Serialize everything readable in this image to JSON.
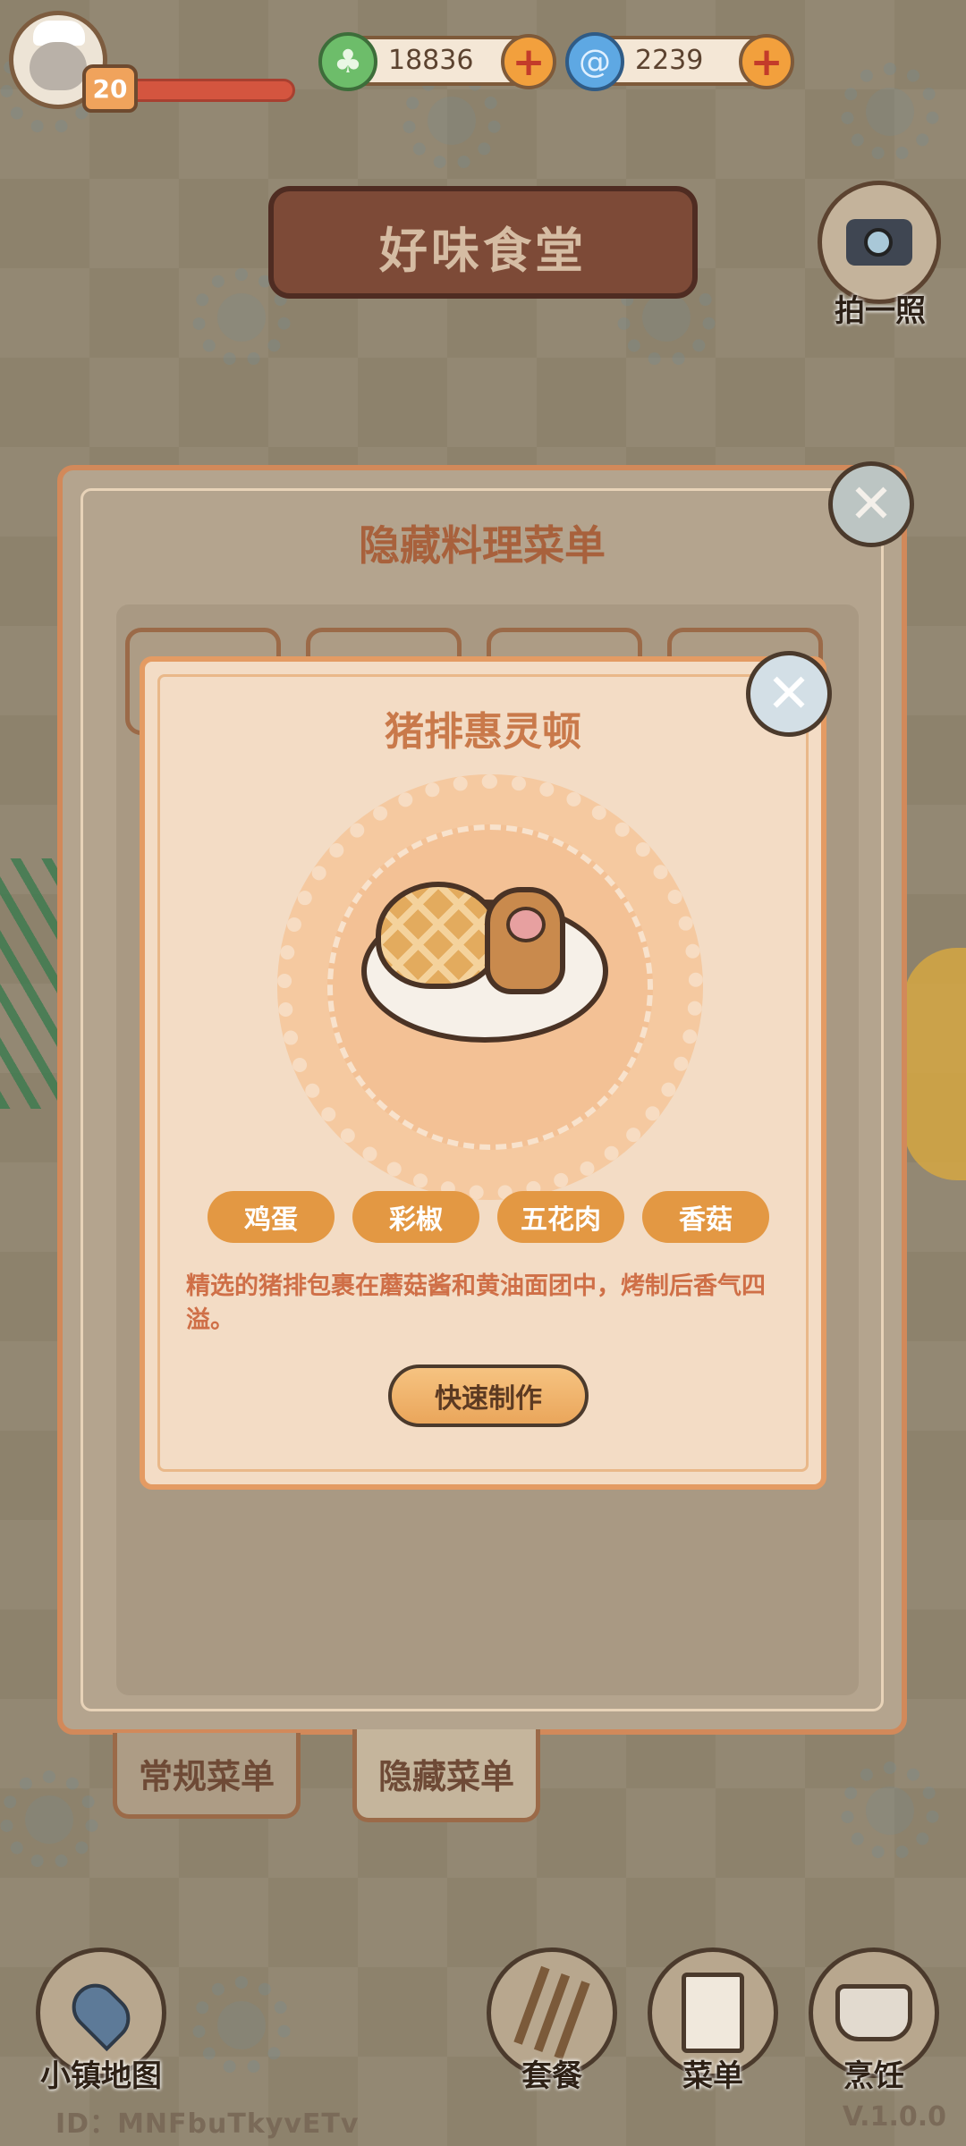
{
  "player": {
    "level": "20",
    "currency_leaf": "18836",
    "currency_swirl": "2239"
  },
  "header": {
    "shop_name": "好味食堂",
    "camera_label": "拍一照"
  },
  "outer_panel": {
    "title": "隐藏料理菜单",
    "tabs": [
      {
        "label": "常规菜单"
      },
      {
        "label": "隐藏菜单"
      }
    ]
  },
  "detail": {
    "dish_name": "猪排惠灵顿",
    "ingredients": [
      "鸡蛋",
      "彩椒",
      "五花肉",
      "香菇"
    ],
    "description": "精选的猪排包裹在蘑菇酱和黄油面团中，烤制后香气四溢。",
    "quick_make_label": "快速制作"
  },
  "bottom_nav": {
    "map_label": "小镇地图",
    "set_meal_label": "套餐",
    "menu_label": "菜单",
    "cook_label": "烹饪"
  },
  "footer": {
    "id_text": "ID：MNFbuTkyvETv",
    "version": "V.1.0.0"
  },
  "colors": {
    "accent": "#e39843",
    "panel_border": "#d2895a",
    "title_text": "#a8613c"
  }
}
